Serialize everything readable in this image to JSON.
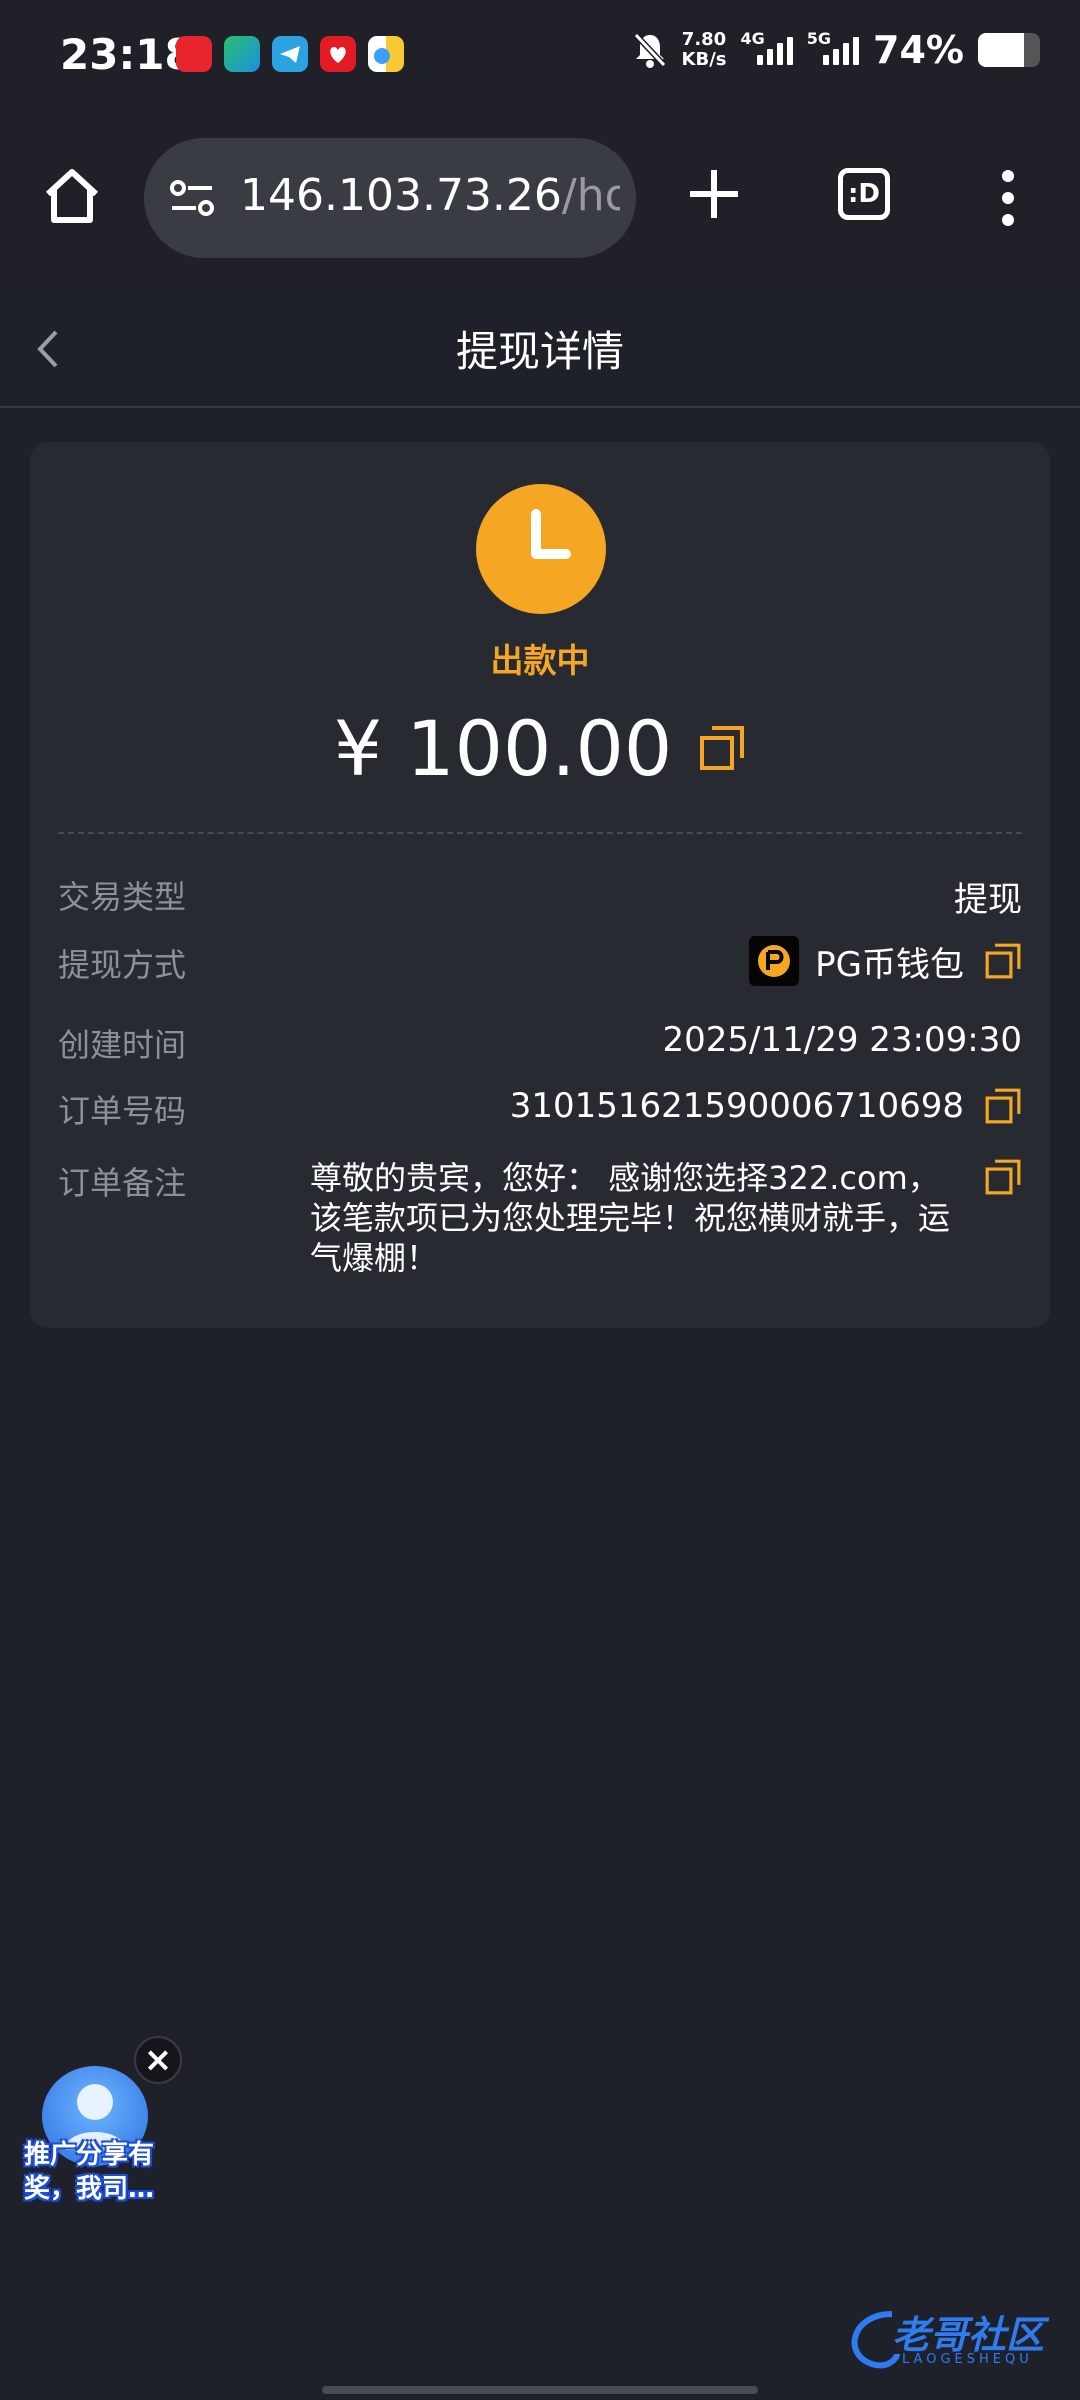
{
  "status_bar": {
    "time": "23:18",
    "net_speed_value": "7.80",
    "net_speed_unit": "KB/s",
    "net_type_1": "4G",
    "net_type_2": "5G",
    "battery_percent": "74%",
    "battery_level": 0.74,
    "icons": [
      "app-icon-red",
      "app-icon-green",
      "telegram-icon",
      "app-icon-red-heart",
      "app-icon-yellow-blue",
      "mute-bell-icon",
      "signal-icon",
      "battery-icon"
    ]
  },
  "browser": {
    "url_main": "146.103.73.26",
    "url_tail": "/hor",
    "tabs_label": ":D",
    "icons": [
      "home-icon",
      "site-settings-icon",
      "plus-icon",
      "tabs-icon",
      "more-vert-icon"
    ]
  },
  "header": {
    "title": "提现详情"
  },
  "detail": {
    "status": "出款中",
    "amount": "¥ 100.00",
    "status_color": "#f5a623",
    "rows": [
      {
        "label": "交易类型",
        "value": "提现"
      },
      {
        "label": "提现方式",
        "value": "PG币钱包"
      },
      {
        "label": "创建时间",
        "value": "2025/11/29 23:09:30"
      },
      {
        "label": "订单号码",
        "value": "310151621590006710698"
      },
      {
        "label": "订单备注",
        "value": "尊敬的贵宾，您好： 感谢您选择322.com，该笔款项已为您处理完毕！祝您横财就手，运气爆棚！"
      }
    ]
  },
  "promo": {
    "text": "推广分享有奖，我司…",
    "close": "×"
  },
  "watermark": {
    "text": "老哥社区",
    "sub": "LAOGESHEQU"
  },
  "colors": {
    "background": "#1f212a",
    "card": "#282a32",
    "accent": "#f5a623"
  }
}
